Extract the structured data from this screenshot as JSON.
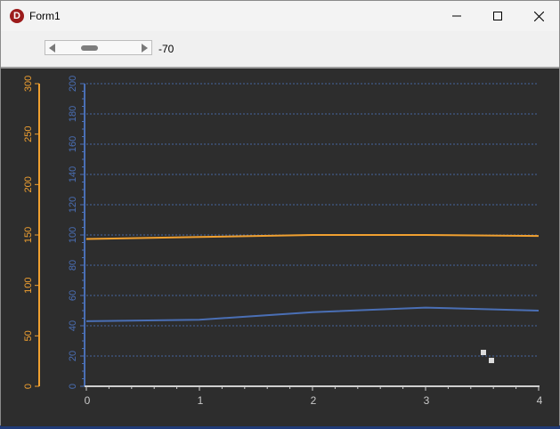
{
  "window": {
    "title": "Form1",
    "app_icon_glyph": "D",
    "app_icon": "delphi-logo-icon",
    "controls": [
      "minimize-icon",
      "maximize-icon",
      "close-icon"
    ]
  },
  "toolbar": {
    "scroll_value": "-70"
  },
  "chart_data": {
    "type": "line",
    "background": "#2d2d2d",
    "grid": true,
    "x": [
      0,
      1,
      2,
      3,
      4
    ],
    "x_ticks": [
      "0",
      "1",
      "2",
      "3",
      "4"
    ],
    "xlim": [
      0,
      4
    ],
    "axes": [
      {
        "id": "left_outer",
        "color": "#f0a030",
        "range": [
          0,
          300
        ],
        "ticks": [
          "0",
          "50",
          "100",
          "150",
          "200",
          "250",
          "300"
        ]
      },
      {
        "id": "left_inner",
        "color": "#4a6fb5",
        "range": [
          0,
          200
        ],
        "ticks": [
          "0",
          "20",
          "40",
          "60",
          "80",
          "100",
          "120",
          "140",
          "160",
          "180",
          "200"
        ]
      }
    ],
    "series": [
      {
        "axis": "left_outer",
        "color": "#f0a030",
        "values": [
          146,
          148,
          150,
          150,
          149
        ]
      },
      {
        "axis": "left_inner",
        "color": "#4a6fb5",
        "values": [
          43,
          44,
          49,
          52,
          50
        ]
      }
    ]
  }
}
